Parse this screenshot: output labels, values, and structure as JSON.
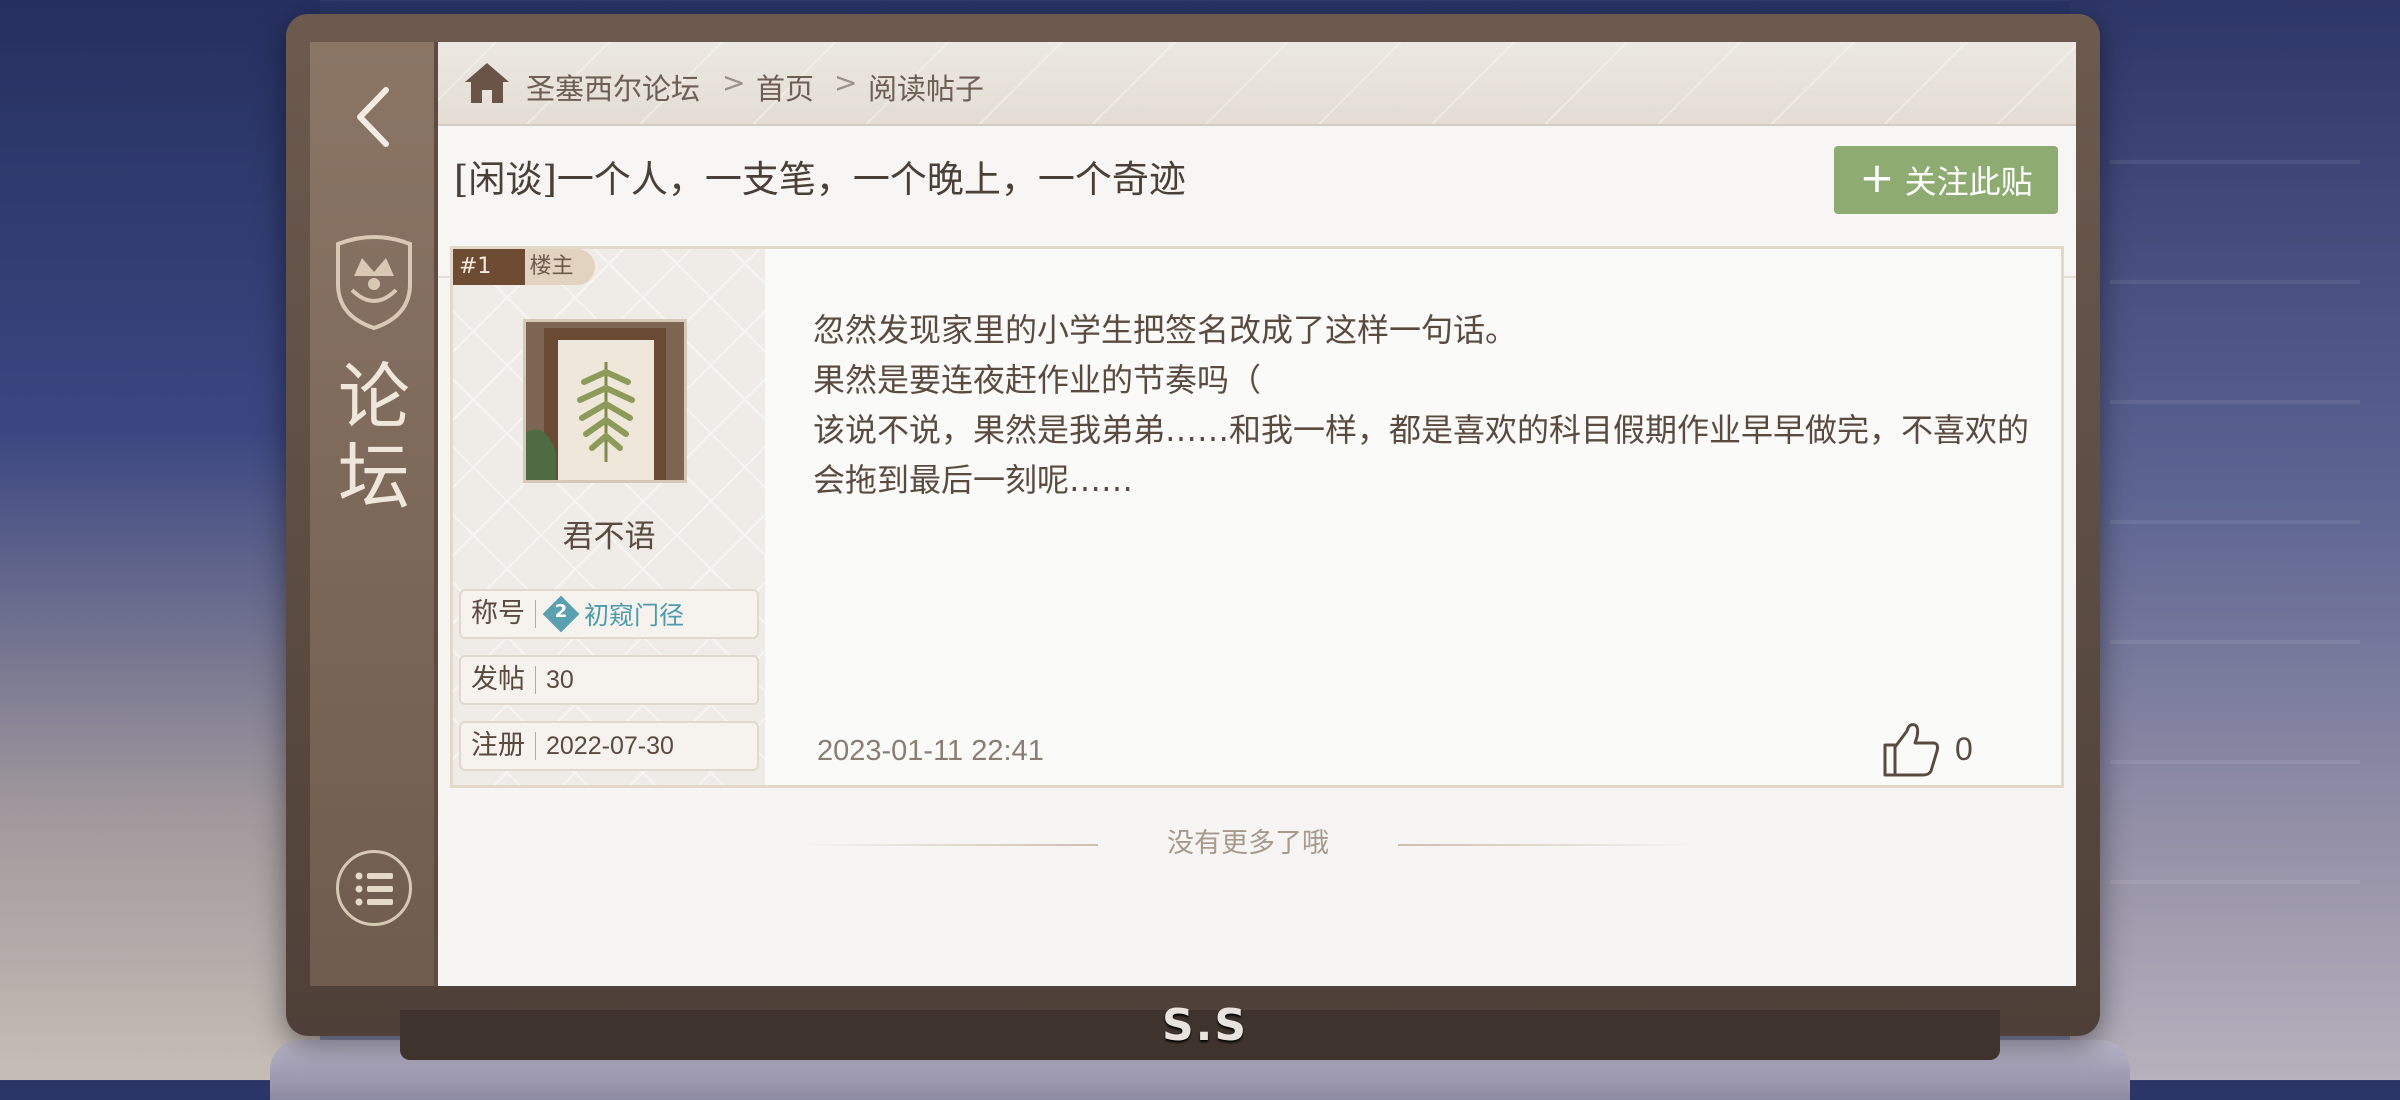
{
  "device": {
    "brand": "S.S"
  },
  "sidebar": {
    "title_line1": "论",
    "title_line2": "坛"
  },
  "breadcrumb": {
    "items": [
      "圣塞西尔论坛",
      "首页",
      "阅读帖子"
    ],
    "separator": ">"
  },
  "post": {
    "title": "[闲谈]一个人，一支笔，一个晚上，一个奇迹",
    "follow_label": "关注此贴",
    "floor": "#1",
    "owner_tag": "楼主",
    "author": "君不语",
    "info": {
      "title_key": "称号",
      "title_rank": "2",
      "title_val": "初窥门径",
      "posts_key": "发帖",
      "posts_val": "30",
      "reg_key": "注册",
      "reg_val": "2022-07-30"
    },
    "content": [
      "忽然发现家里的小学生把签名改成了这样一句话。",
      "果然是要连夜赶作业的节奏吗（",
      "该说不说，果然是我弟弟……和我一样，都是喜欢的科目假期作业早早做完，不喜欢的会拖到最后一刻呢……"
    ],
    "time": "2023-01-11  22:41",
    "likes": "0"
  },
  "footer": {
    "end_text": "没有更多了哦"
  },
  "colors": {
    "accent_green": "#8eab72",
    "sidebar": "#7a6657",
    "floor_badge": "#6e4b33",
    "rank_teal": "#4e9bab"
  }
}
